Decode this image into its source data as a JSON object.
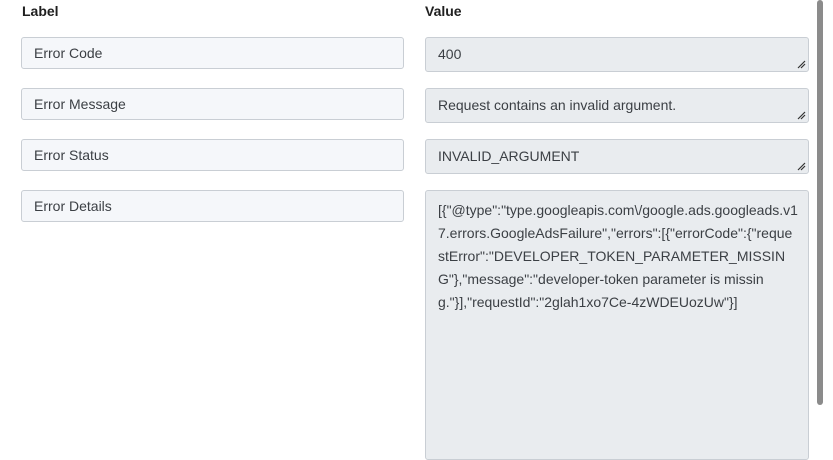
{
  "headers": {
    "label": "Label",
    "value": "Value"
  },
  "rows": [
    {
      "label": "Error Code",
      "value": "400"
    },
    {
      "label": "Error Message",
      "value": "Request contains an invalid argument."
    },
    {
      "label": "Error Status",
      "value": "INVALID_ARGUMENT"
    },
    {
      "label": "Error Details",
      "value": "[{\"@type\":\"type.googleapis.com\\/google.ads.googleads.v17.errors.GoogleAdsFailure\",\"errors\":[{\"errorCode\":{\"requestError\":\"DEVELOPER_TOKEN_PARAMETER_MISSING\"},\"message\":\"developer-token parameter is missing.\"}],\"requestId\":\"2glah1xo7Ce-4zWDEUozUw\"}]"
    }
  ]
}
